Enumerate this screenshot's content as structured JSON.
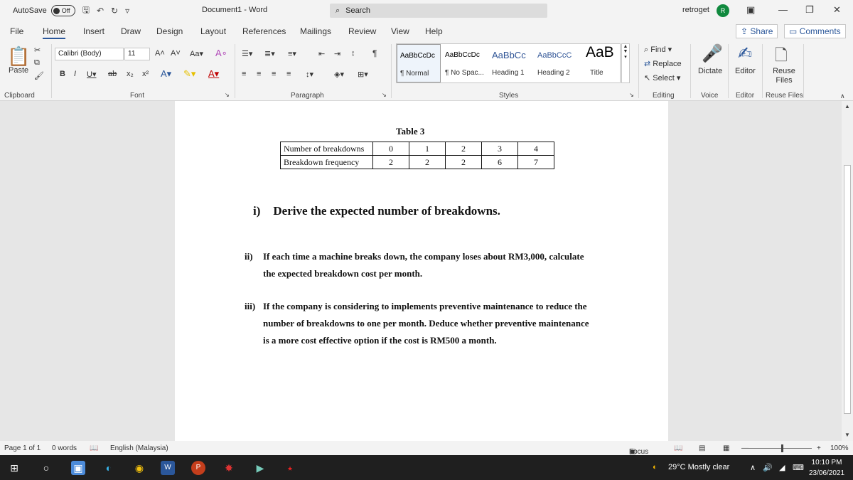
{
  "titlebar": {
    "autosave_label": "AutoSave",
    "autosave_state": "Off",
    "doc_title": "Document1  -  Word",
    "search_label": "Search",
    "user_name": "retroget",
    "user_initial": "R"
  },
  "tabs": [
    "File",
    "Home",
    "Insert",
    "Draw",
    "Design",
    "Layout",
    "References",
    "Mailings",
    "Review",
    "View",
    "Help"
  ],
  "share_label": "Share",
  "comments_label": "Comments",
  "ribbon": {
    "paste_label": "Paste",
    "clipboard_label": "Clipboard",
    "font_name": "Calibri (Body)",
    "font_size": "11",
    "font_label": "Font",
    "paragraph_label": "Paragraph",
    "styles_label": "Styles",
    "styles": [
      {
        "sample": "AaBbCcDc",
        "name": "¶ Normal"
      },
      {
        "sample": "AaBbCcDc",
        "name": "¶ No Spac..."
      },
      {
        "sample": "AaBbCc",
        "name": "Heading 1"
      },
      {
        "sample": "AaBbCcC",
        "name": "Heading 2"
      },
      {
        "sample": "AaB",
        "name": "Title"
      }
    ],
    "find_label": "Find",
    "replace_label": "Replace",
    "select_label": "Select",
    "editing_label": "Editing",
    "dictate_label": "Dictate",
    "voice_label": "Voice",
    "editor_label": "Editor",
    "editor_group_label": "Editor",
    "reuse_label": "Reuse Files",
    "reuse_group_label": "Reuse Files"
  },
  "document": {
    "table_title": "Table 3",
    "table": {
      "rows": [
        {
          "header": "Number of breakdowns",
          "values": [
            "0",
            "1",
            "2",
            "3",
            "4"
          ]
        },
        {
          "header": "Breakdown frequency",
          "values": [
            "2",
            "2",
            "2",
            "6",
            "7"
          ]
        }
      ]
    },
    "q1_num": "i)",
    "q1_text": "Derive the expected number of breakdowns.",
    "q2_num": "ii)",
    "q2_line1": "If each time a machine breaks down, the company loses about RM3,000, calculate",
    "q2_line2": "the expected breakdown cost per month.",
    "q3_num": "iii)",
    "q3_line1": "If the company is considering to implements preventive maintenance to reduce the",
    "q3_line2": "number of breakdowns to one per month. Deduce whether preventive maintenance",
    "q3_line3": "is a more cost effective option if the cost is RM500 a month."
  },
  "status": {
    "page": "Page 1 of 1",
    "words": "0 words",
    "language": "English (Malaysia)",
    "focus": "Focus",
    "zoom": "100%"
  },
  "taskbar": {
    "weather": "29°C  Mostly clear",
    "time": "10:10 PM",
    "date": "23/06/2021"
  }
}
